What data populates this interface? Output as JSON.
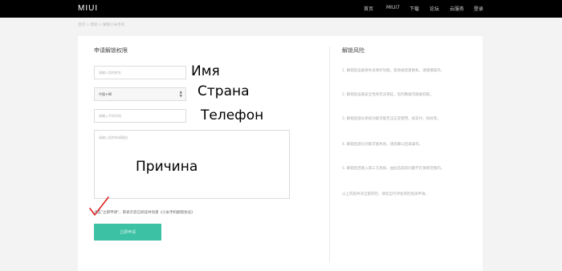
{
  "header": {
    "logo": "MIUI",
    "nav": [
      "首页",
      "MIUI7",
      "下载",
      "论坛",
      "云服务",
      "登录"
    ]
  },
  "breadcrumb": "首页 > 帮助 > 解锁小米手机",
  "form": {
    "title": "申请解锁权限",
    "name_placeholder": "请输入您的姓名",
    "country_value": "中国+86",
    "phone_placeholder": "请输入手机号码",
    "reason_placeholder": "请输入您的申请理由",
    "agreement_text": "点击\"立即申请\"，即表示您已阅读并同意",
    "agreement_link": "《小米手机解锁协议》",
    "submit_label": "立即申请"
  },
  "annotations": {
    "name": "Имя",
    "country": "Страна",
    "phone": "Телефон",
    "reason": "Причина",
    "check_color": "#e02020"
  },
  "sidebar": {
    "title": "解锁风险",
    "paragraphs": [
      "1. 解锁后设备将失去保护功能，容易被恶意刷机，请谨慎操作。",
      "2. 解锁后设备安全性将无法保证，您的数据可能被窃取。",
      "3. 解锁后部分系统功能可能无法正常使用，如支付、指纹等。",
      "4. 解锁后部分功能可能失效，请您确认后再操作。",
      "5. 解锁后若刷入第三方系统，由此造成的问题不在保修范围内。",
      "以上内容并非全部风险，请您自行评估风险后再申请。"
    ]
  }
}
